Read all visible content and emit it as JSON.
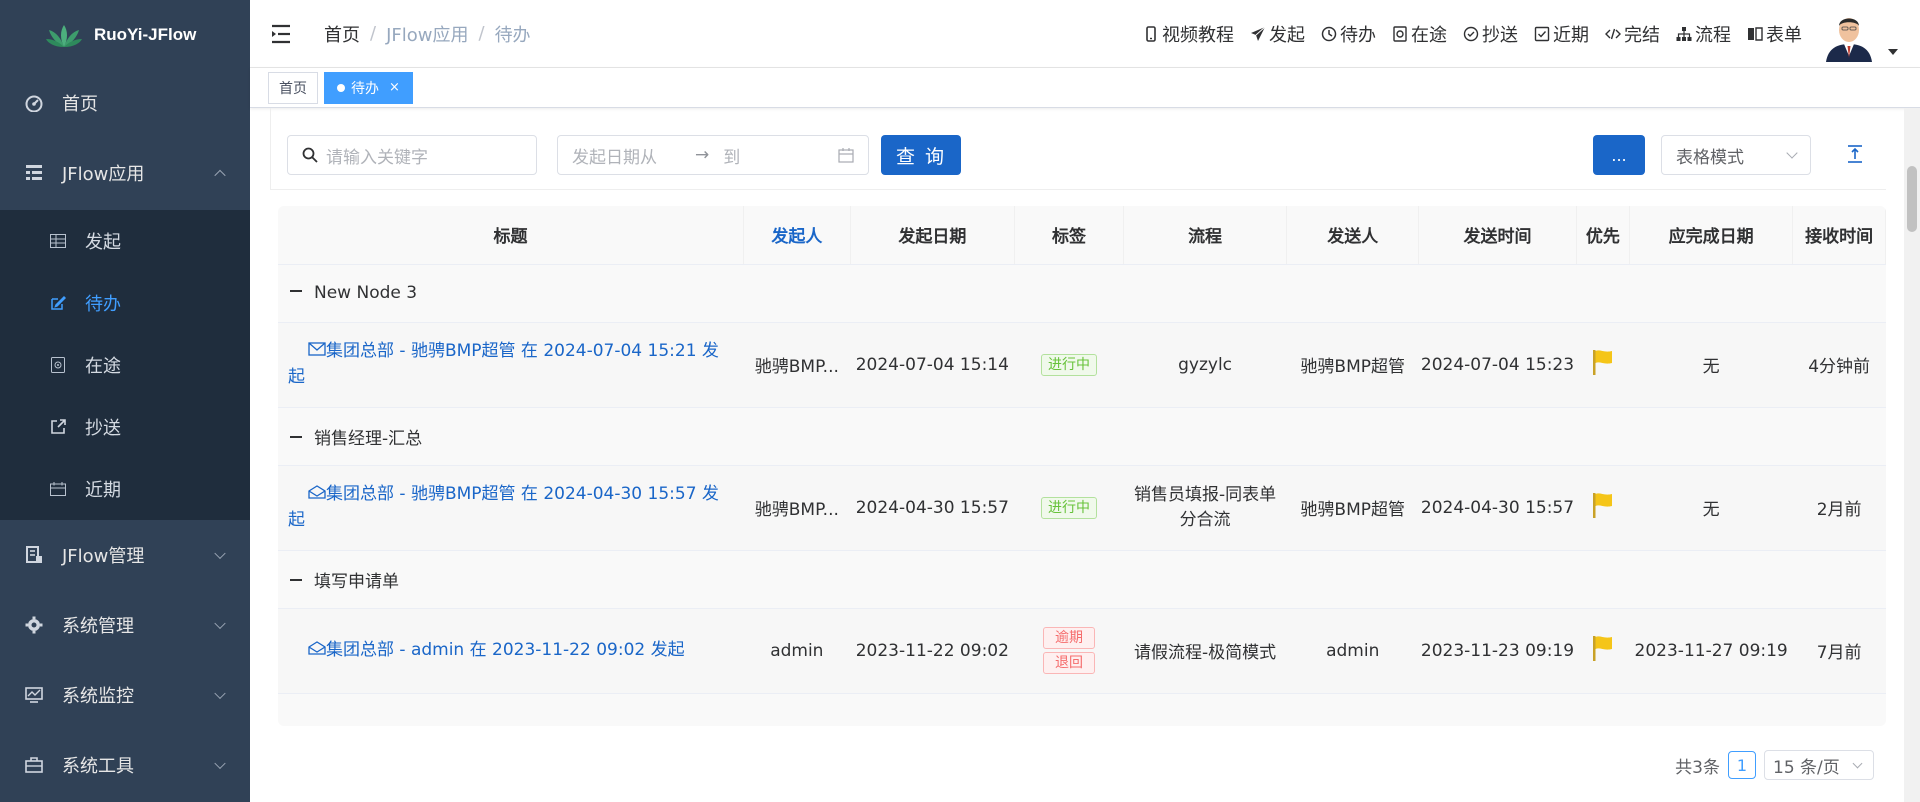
{
  "app": {
    "title": "RuoYi-JFlow"
  },
  "sidebar": {
    "items": [
      {
        "label": "首页",
        "icon": "dashboard-icon"
      },
      {
        "label": "JFlow应用",
        "icon": "tree-table-icon",
        "expanded": true,
        "children": [
          {
            "label": "发起",
            "icon": "grid-icon"
          },
          {
            "label": "待办",
            "icon": "edit-icon",
            "active": true
          },
          {
            "label": "在途",
            "icon": "eye-icon"
          },
          {
            "label": "抄送",
            "icon": "external-link-icon"
          },
          {
            "label": "近期",
            "icon": "calendar-icon"
          }
        ]
      },
      {
        "label": "JFlow管理",
        "icon": "server-icon"
      },
      {
        "label": "系统管理",
        "icon": "gear-icon"
      },
      {
        "label": "系统监控",
        "icon": "monitor-icon"
      },
      {
        "label": "系统工具",
        "icon": "toolbox-icon"
      }
    ]
  },
  "header": {
    "breadcrumb": [
      "首页",
      "JFlow应用",
      "待办"
    ],
    "nav": [
      {
        "label": "视频教程",
        "icon": "phone-icon"
      },
      {
        "label": "发起",
        "icon": "send-icon"
      },
      {
        "label": "待办",
        "icon": "clock-icon"
      },
      {
        "label": "在途",
        "icon": "eye-icon"
      },
      {
        "label": "抄送",
        "icon": "check-circle-icon"
      },
      {
        "label": "近期",
        "icon": "check-square-icon"
      },
      {
        "label": "完结",
        "icon": "code-icon"
      },
      {
        "label": "流程",
        "icon": "sitemap-icon"
      },
      {
        "label": "表单",
        "icon": "book-icon"
      }
    ]
  },
  "tags": [
    {
      "label": "首页",
      "active": false
    },
    {
      "label": "待办",
      "active": true,
      "close": "×"
    }
  ],
  "toolbar": {
    "search_placeholder": "请输入关键字",
    "date_from_placeholder": "发起日期从",
    "date_arrow": "→",
    "date_to_placeholder": "到",
    "query_label": "查 询",
    "more_label": "...",
    "mode_value": "表格模式"
  },
  "table": {
    "columns": [
      "标题",
      "发起人",
      "发起日期",
      "标签",
      "流程",
      "发送人",
      "发送时间",
      "优先",
      "应完成日期",
      "接收时间"
    ],
    "groups": [
      {
        "name": "New Node 3",
        "rows": [
          {
            "title": "集团总部 - 驰骋BMP超管 在 2024-07-04 15:21 发起",
            "starter": "驰骋BMP...",
            "start_date": "2024-07-04 15:14",
            "tags": [
              "进行中"
            ],
            "tag_colors": [
              "green"
            ],
            "flow": "gyzylc",
            "sender": "驰骋BMP超管",
            "send_time": "2024-07-04 15:23",
            "due_date": "无",
            "received": "4分钟前",
            "title_icon": "envelope-icon"
          }
        ]
      },
      {
        "name": "销售经理-汇总",
        "rows": [
          {
            "title": "集团总部 - 驰骋BMP超管 在 2024-04-30 15:57 发起",
            "starter": "驰骋BMP...",
            "start_date": "2024-04-30 15:57",
            "tags": [
              "进行中"
            ],
            "tag_colors": [
              "green"
            ],
            "flow": "销售员填报-同表单分合流",
            "sender": "驰骋BMP超管",
            "send_time": "2024-04-30 15:57",
            "due_date": "无",
            "received": "2月前",
            "title_icon": "envelope-open-icon"
          }
        ]
      },
      {
        "name": "填写申请单",
        "rows": [
          {
            "title": "集团总部 - admin 在 2023-11-22 09:02 发起",
            "starter": "admin",
            "start_date": "2023-11-22 09:02",
            "tags": [
              "逾期",
              "退回"
            ],
            "tag_colors": [
              "red",
              "red"
            ],
            "flow": "请假流程-极简模式",
            "sender": "admin",
            "send_time": "2023-11-23 09:19",
            "due_date": "2023-11-27 09:19",
            "received": "7月前",
            "title_icon": "envelope-open-icon"
          }
        ]
      }
    ]
  },
  "pagination": {
    "total_text": "共3条",
    "current_page": "1",
    "page_size": "15 条/页"
  },
  "colors": {
    "sidebar_bg": "#304156",
    "submenu_bg": "#1f2d3d",
    "accent": "#409eff",
    "button": "#1a66c8",
    "flag": "#f5c518"
  }
}
